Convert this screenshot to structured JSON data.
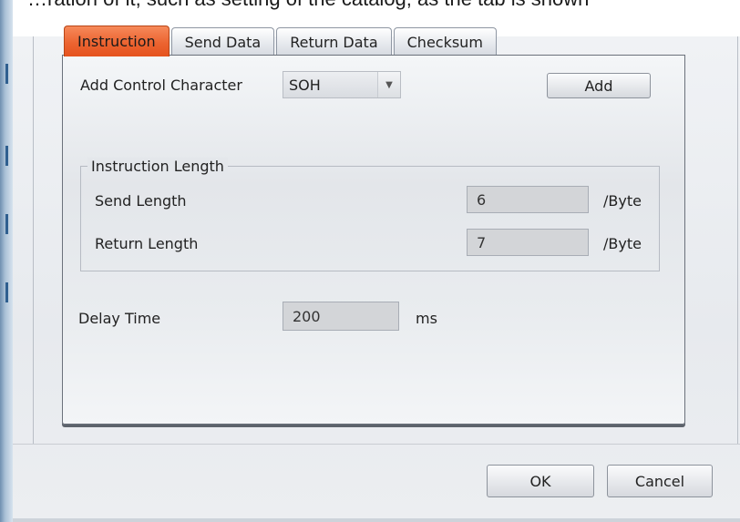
{
  "header_text": "…ration of it, such as setting of the catalog; as the tab is shown",
  "tabs": [
    {
      "label": "Instruction",
      "active": true
    },
    {
      "label": "Send Data",
      "active": false
    },
    {
      "label": "Return Data",
      "active": false
    },
    {
      "label": "Checksum",
      "active": false
    }
  ],
  "instruction": {
    "control_char_label": "Add Control Character",
    "control_char_value": "SOH",
    "add_button": "Add",
    "length_group": {
      "title": "Instruction Length",
      "send_label": "Send Length",
      "send_value": "6",
      "send_unit": "/Byte",
      "return_label": "Return Length",
      "return_value": "7",
      "return_unit": "/Byte"
    },
    "delay_label": "Delay Time",
    "delay_value": "200",
    "delay_unit": "ms"
  },
  "dialog_buttons": {
    "ok": "OK",
    "cancel": "Cancel"
  },
  "colors": {
    "active_tab": "#ec6431",
    "panel_border": "#6b717b",
    "field_bg": "#d3d5d8"
  }
}
